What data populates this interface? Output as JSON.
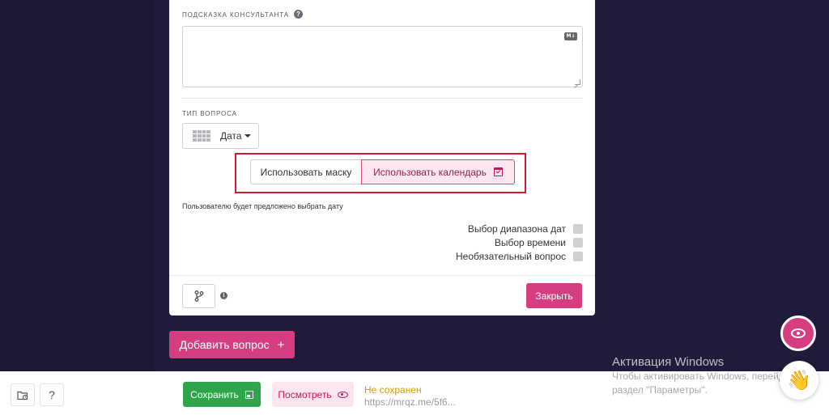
{
  "card": {
    "consultant_hint_label": "ПОДСКАЗКА КОНСУЛЬТАНТА",
    "help_glyph": "?",
    "md_badge": "M↓",
    "question_type_label": "ТИП ВОПРОСА",
    "question_type_value": "Дата",
    "use_mask": "Использовать маску",
    "use_calendar": "Использовать календарь",
    "hint_text": "Пользователю будет предложено выбрать дату",
    "options": [
      {
        "label": "Выбор диапазона дат",
        "checked": false
      },
      {
        "label": "Выбор времени",
        "checked": false
      },
      {
        "label": "Необязательный вопрос",
        "checked": false
      }
    ],
    "info_glyph": "i",
    "close_label": "Закрыть"
  },
  "add_question": {
    "label": "Добавить вопрос",
    "plus": "+"
  },
  "bottom": {
    "help_glyph": "?",
    "save_label": "Сохранить",
    "preview_label": "Посмотреть",
    "status": "Не сохранен",
    "url": "https://mrqz.me/5f6..."
  },
  "fab": {
    "wave_emoji": "👋"
  },
  "windows": {
    "title": "Активация Windows",
    "line1": "Чтобы активировать Windows, перейдите",
    "line2": "раздел \"Параметры\"."
  },
  "colors": {
    "accent": "#d63c80",
    "save_green": "#2ea54a",
    "status_amber": "#d39b00",
    "highlight_red": "#c81e2e",
    "background": "#1f1c3b"
  }
}
